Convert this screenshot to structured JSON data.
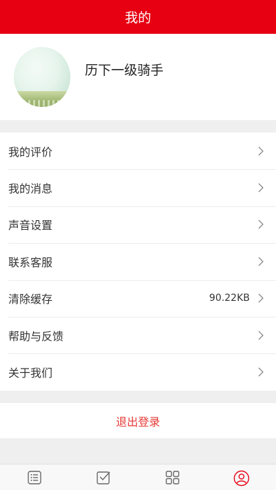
{
  "header": {
    "title": "我的"
  },
  "profile": {
    "username": "历下一级骑手"
  },
  "menu": {
    "items": [
      {
        "label": "我的评价",
        "value": ""
      },
      {
        "label": "我的消息",
        "value": ""
      },
      {
        "label": "声音设置",
        "value": ""
      },
      {
        "label": "联系客服",
        "value": ""
      },
      {
        "label": "清除缓存",
        "value": "90.22KB"
      },
      {
        "label": "帮助与反馈",
        "value": ""
      },
      {
        "label": "关于我们",
        "value": ""
      }
    ]
  },
  "logout": {
    "label": "退出登录"
  },
  "tabbar": {
    "active_color": "#e60012",
    "items": [
      {
        "icon": "list-icon",
        "label": "",
        "active": false
      },
      {
        "icon": "checkbox-icon",
        "label": "",
        "active": false
      },
      {
        "icon": "grid-icon",
        "label": "",
        "active": false
      },
      {
        "icon": "user-icon",
        "label": "",
        "active": true
      }
    ]
  },
  "colors": {
    "brand": "#e60012",
    "logout_text": "#e53935"
  }
}
